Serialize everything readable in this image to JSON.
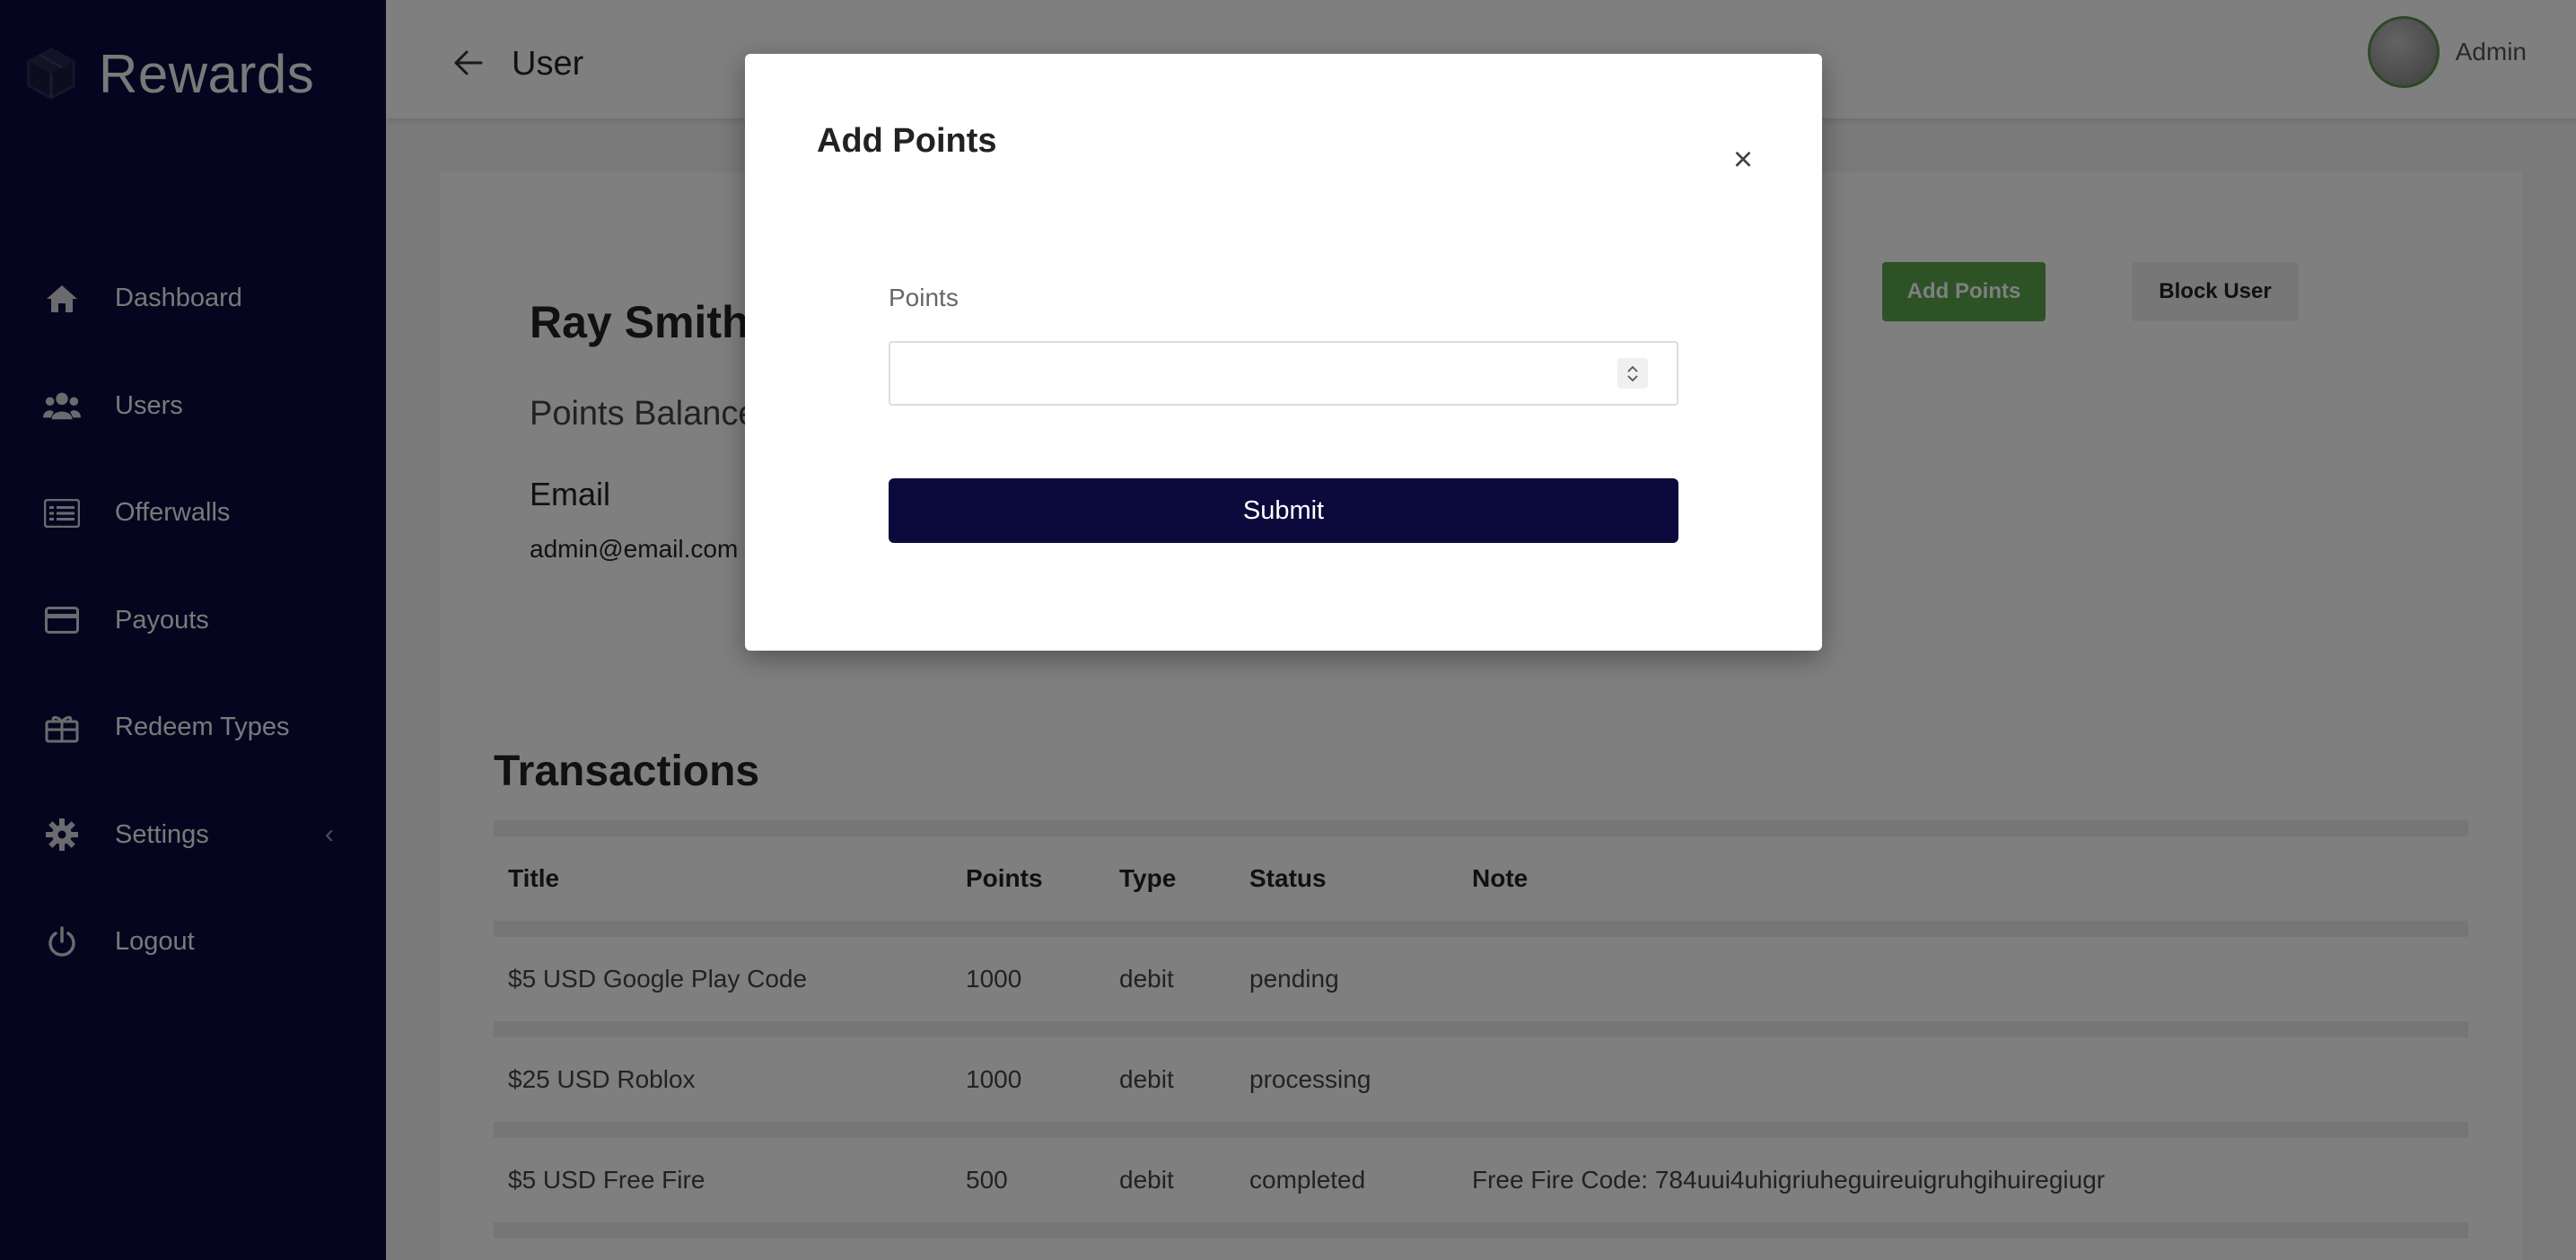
{
  "sidebar": {
    "brand": "Rewards",
    "items": [
      {
        "label": "Dashboard",
        "icon": "home-icon"
      },
      {
        "label": "Users",
        "icon": "users-icon"
      },
      {
        "label": "Offerwalls",
        "icon": "list-icon"
      },
      {
        "label": "Payouts",
        "icon": "credit-card-icon"
      },
      {
        "label": "Redeem Types",
        "icon": "gift-icon"
      },
      {
        "label": "Settings",
        "icon": "gear-icon"
      },
      {
        "label": "Logout",
        "icon": "power-icon"
      }
    ]
  },
  "header": {
    "title": "User",
    "user": "Admin"
  },
  "profile": {
    "name": "Ray Smith",
    "points_balance_label": "Points Balance",
    "email_label": "Email",
    "email": "admin@email.com",
    "add_points_label": "Add Points",
    "block_user_label": "Block User"
  },
  "transactions": {
    "title": "Transactions",
    "columns": [
      "Title",
      "Points",
      "Type",
      "Status",
      "Note"
    ],
    "rows": [
      {
        "title": "$5 USD Google Play Code",
        "points": "1000",
        "type": "debit",
        "status": "pending",
        "note": ""
      },
      {
        "title": "$25 USD Roblox",
        "points": "1000",
        "type": "debit",
        "status": "processing",
        "note": ""
      },
      {
        "title": "$5 USD Free Fire",
        "points": "500",
        "type": "debit",
        "status": "completed",
        "note": "Free Fire Code: 784uui4uhigriuheguireuigruhgihuiregiugr"
      }
    ]
  },
  "modal": {
    "title": "Add Points",
    "field_label": "Points",
    "field_value": "",
    "submit_label": "Submit"
  },
  "colors": {
    "sidebar_bg": "#0d0b3e",
    "add_points_btn": "#5aa44c",
    "submit_btn": "#0c0a3c"
  }
}
